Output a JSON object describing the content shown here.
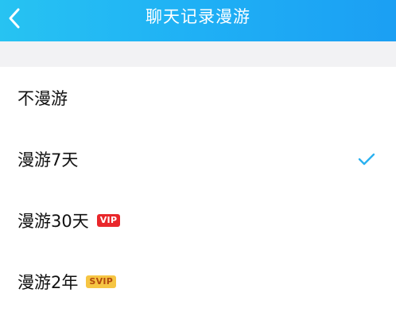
{
  "header": {
    "title": "聊天记录漫游",
    "back_icon": "chevron-left-icon"
  },
  "options": [
    {
      "label": "不漫游",
      "badge": "",
      "selected": false
    },
    {
      "label": "漫游7天",
      "badge": "",
      "selected": true
    },
    {
      "label": "漫游30天",
      "badge": "VIP",
      "selected": false
    },
    {
      "label": "漫游2年",
      "badge": "SVIP",
      "selected": false
    }
  ],
  "colors": {
    "header_start": "#27c3f2",
    "header_end": "#1b9ff3",
    "check": "#2bb1f0",
    "vip_badge": "#e9272b",
    "svip_badge": "#f6c543"
  }
}
